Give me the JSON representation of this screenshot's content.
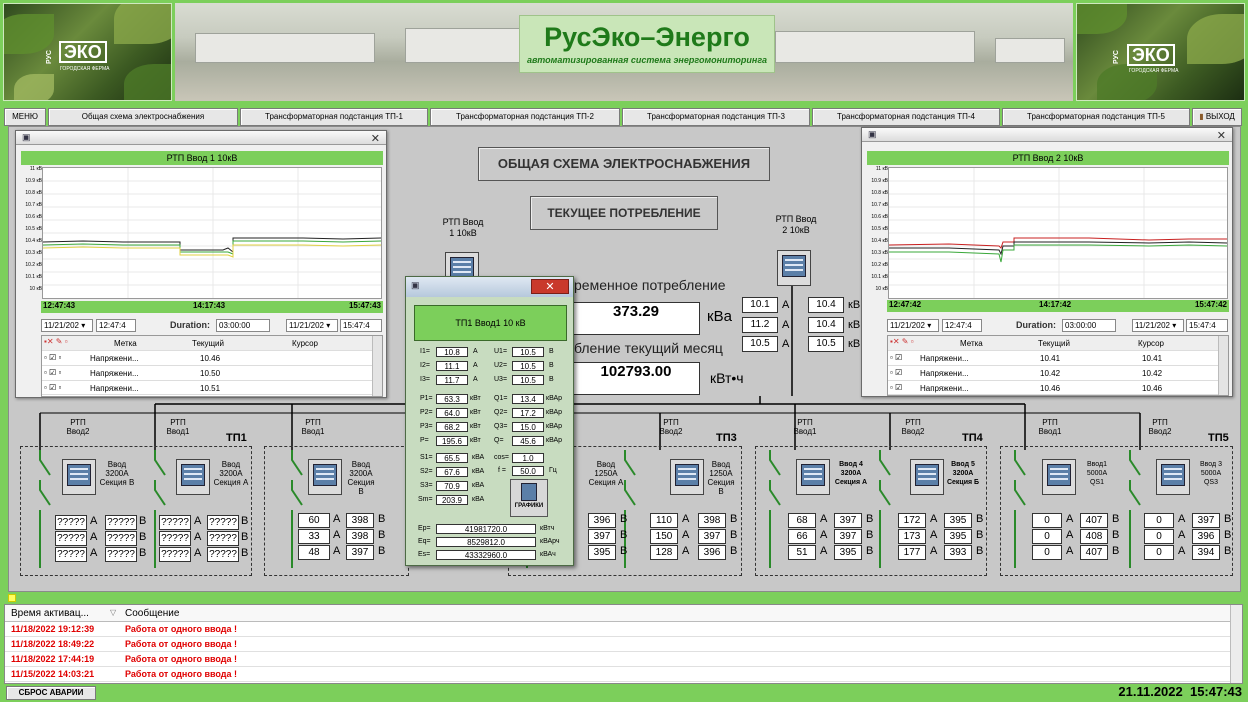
{
  "header": {
    "brand_logo_text": "ЭКО",
    "brand_logo_prefix": "РУС",
    "brand_logo_sub": "ГОРОДСКАЯ ФЕРМА",
    "title": "РусЭко–Энерго",
    "subtitle": "автоматизированная система энергомониторинга"
  },
  "nav": {
    "menu": "МЕНЮ",
    "tabs": [
      "Общая схема электроснабжения",
      "Трансформаторная подстанция ТП-1",
      "Трансформаторная подстанция ТП-2",
      "Трансформаторная подстанция ТП-3",
      "Трансформаторная подстанция ТП-4",
      "Трансформаторная подстанция ТП-5"
    ],
    "exit": "ВЫХОД"
  },
  "main": {
    "scheme_button": "ОБЩАЯ СХЕМА ЭЛЕКТРОСНАБЖЕНИЯ",
    "current_button": "ТЕКУЩЕЕ ПОТРЕБЛЕНИЕ",
    "rtp1_label": "РТП Ввод 1 10кВ",
    "rtp2_label": "РТП Ввод 2 10кВ",
    "consumption_label": "ременное потребление",
    "consumption_value": "373.29",
    "consumption_unit": "кВа",
    "month_label": "бление текущий месяц",
    "month_value": "102793.00",
    "month_unit": "кВт•ч",
    "amps": [
      "10.1",
      "11.2",
      "10.5"
    ],
    "amp_unit": "А",
    "volts": [
      "10.4",
      "10.4",
      "10.5"
    ],
    "volt_unit": "кВ"
  },
  "trend1": {
    "header": "РТП Ввод 1 10кВ",
    "y_ticks": [
      "11 кВ",
      "10.9 кВ",
      "10.8 кВ",
      "10.7 кВ",
      "10.6 кВ",
      "10.5 кВ",
      "10.4 кВ",
      "10.3 кВ",
      "10.2 кВ",
      "10.1 кВ",
      "10 кВ"
    ],
    "x_ticks": [
      "12:47:43",
      "14:17:43",
      "15:47:43"
    ],
    "date_left": "11/21/202",
    "time_left": "12:47:4",
    "duration_label": "Duration:",
    "duration": "03:00:00",
    "date_right": "11/21/202",
    "time_right": "15:47:4",
    "columns": [
      "Метка",
      "Текущий",
      "Курсор"
    ],
    "rows": [
      {
        "label": "Напряжени...",
        "current": "10.46",
        "cursor": ""
      },
      {
        "label": "Напряжени...",
        "current": "10.50",
        "cursor": ""
      },
      {
        "label": "Напряжени...",
        "current": "10.51",
        "cursor": ""
      }
    ]
  },
  "trend2": {
    "header": "РТП Ввод 2 10кВ",
    "y_ticks": [
      "11 кВ",
      "10.9 кВ",
      "10.8 кВ",
      "10.7 кВ",
      "10.6 кВ",
      "10.5 кВ",
      "10.4 кВ",
      "10.3 кВ",
      "10.2 кВ",
      "10.1 кВ",
      "10 кВ"
    ],
    "x_ticks": [
      "12:47:42",
      "14:17:42",
      "15:47:42"
    ],
    "date_left": "11/21/202",
    "time_left": "12:47:4",
    "duration_label": "Duration:",
    "duration": "03:00:00",
    "date_right": "11/21/202",
    "time_right": "15:47:4",
    "columns": [
      "Метка",
      "Текущий",
      "Курсор"
    ],
    "rows": [
      {
        "label": "Напряжени...",
        "current": "10.41",
        "cursor": "10.41"
      },
      {
        "label": "Напряжени...",
        "current": "10.42",
        "cursor": "10.42"
      },
      {
        "label": "Напряжени...",
        "current": "10.46",
        "cursor": "10.46"
      }
    ]
  },
  "popup": {
    "header": "ТП1 Ввод1 10 кВ",
    "currents": [
      {
        "k": "I1=",
        "v": "10.8",
        "u": "А"
      },
      {
        "k": "I2=",
        "v": "11.1",
        "u": "А"
      },
      {
        "k": "I3=",
        "v": "11.7",
        "u": "А"
      }
    ],
    "voltages": [
      {
        "k": "U1=",
        "v": "10.5",
        "u": "В"
      },
      {
        "k": "U2=",
        "v": "10.5",
        "u": "В"
      },
      {
        "k": "U3=",
        "v": "10.5",
        "u": "В"
      }
    ],
    "active": [
      {
        "k": "P1=",
        "v": "63.3",
        "u": "кВт"
      },
      {
        "k": "P2=",
        "v": "64.0",
        "u": "кВт"
      },
      {
        "k": "P3=",
        "v": "68.2",
        "u": "кВт"
      },
      {
        "k": "P=",
        "v": "195.6",
        "u": "кВт"
      }
    ],
    "reactive": [
      {
        "k": "Q1=",
        "v": "13.4",
        "u": "кВАр"
      },
      {
        "k": "Q2=",
        "v": "17.2",
        "u": "кВАр"
      },
      {
        "k": "Q3=",
        "v": "15.0",
        "u": "кВАр"
      },
      {
        "k": "Q=",
        "v": "45.6",
        "u": "кВАр"
      }
    ],
    "apparent": [
      {
        "k": "S1=",
        "v": "65.5",
        "u": "кВА"
      },
      {
        "k": "S2=",
        "v": "67.6",
        "u": "кВА"
      },
      {
        "k": "S3=",
        "v": "70.9",
        "u": "кВА"
      },
      {
        "k": "Sm=",
        "v": "203.9",
        "u": "кВА"
      }
    ],
    "cos_label": "cos=",
    "cos": "1.0",
    "f_label": "f =",
    "f": "50.0",
    "f_unit": "Гц",
    "graphs_button": "ГРАФИКИ",
    "energy": [
      {
        "k": "Ep=",
        "v": "41981720.0",
        "u": "кВтч"
      },
      {
        "k": "Eq=",
        "v": "8529812.0",
        "u": "кВАрч"
      },
      {
        "k": "Es=",
        "v": "43332960.0",
        "u": "кВАч"
      }
    ]
  },
  "substations": {
    "rtp_vvod2": "РТП Ввод2",
    "rtp_vvod1": "РТП Ввод1",
    "tp1": {
      "name": "ТП1",
      "m1": "Ввод 3200А Секция В",
      "m2": "Ввод 3200А Секция А",
      "left": [
        "?????",
        "?????",
        "?????"
      ],
      "right": [
        "?????",
        "?????",
        "?????"
      ]
    },
    "tp2": {
      "m1": "Ввод 3200А Секция В",
      "left": [
        "60",
        "33",
        "48"
      ],
      "right": [
        "398",
        "398",
        "397"
      ]
    },
    "tp3": {
      "name": "ТП3",
      "m1": "Ввод 1250А Секция А",
      "m2": "Ввод 1250А Секция В",
      "left": [
        "396",
        "397",
        "395"
      ],
      "mid": [
        "110",
        "150",
        "128"
      ],
      "right": [
        "398",
        "397",
        "396"
      ]
    },
    "tp4": {
      "name": "ТП4",
      "m1": "Ввод 4 3200А Секция А",
      "m2": "Ввод 5 3200А Секция Б",
      "left": [
        "68",
        "66",
        "51"
      ],
      "mid": [
        "397",
        "397",
        "395"
      ],
      "mid2": [
        "172",
        "173",
        "177"
      ],
      "right": [
        "395",
        "395",
        "393"
      ]
    },
    "tp5": {
      "name": "ТП5",
      "m1": "Ввод1 5000А QS1",
      "m2": "Ввод 3 5000А QS3",
      "left": [
        "0",
        "0",
        "0"
      ],
      "mid": [
        "407",
        "408",
        "407"
      ],
      "mid2": [
        "0",
        "0",
        "0"
      ],
      "right": [
        "397",
        "396",
        "394"
      ]
    },
    "a": "А",
    "v": "В"
  },
  "alarms": {
    "col_time": "Время активац...",
    "col_msg": "Сообщение",
    "rows": [
      {
        "time": "11/18/2022 19:12:39",
        "msg": "Работа от одного ввода !"
      },
      {
        "time": "11/18/2022 18:49:22",
        "msg": "Работа от одного ввода !"
      },
      {
        "time": "11/18/2022 17:44:19",
        "msg": "Работа от одного ввода !"
      },
      {
        "time": "11/15/2022 14:03:21",
        "msg": "Работа от одного ввода !"
      }
    ]
  },
  "footer": {
    "reset": "СБРОС АВАРИИ",
    "datetime": "21.11.2022  15:47:43"
  }
}
